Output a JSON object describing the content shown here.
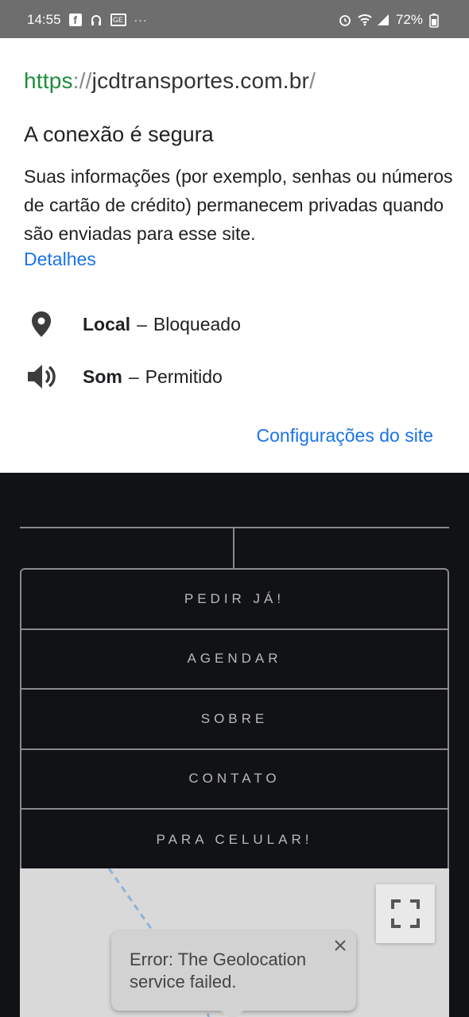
{
  "status_bar": {
    "time": "14:55",
    "icons_left": [
      "facebook-icon",
      "headphone-icon",
      "ge-icon",
      "more-dots-icon"
    ],
    "icons_right": [
      "alarm-icon",
      "wifi-icon",
      "signal-icon",
      "battery-icon"
    ],
    "battery": "72%",
    "more": "···"
  },
  "popup": {
    "url": {
      "protocol": "https",
      "separator": "://",
      "host": "jcdtransportes.com.br",
      "trailing": "/"
    },
    "title": "A conexão é segura",
    "description": "Suas informações (por exemplo, senhas ou números de cartão de crédito) permanecem privadas quando são enviadas para esse site.",
    "details_link": "Detalhes",
    "permissions": [
      {
        "icon": "location-pin-icon",
        "name": "Local",
        "dash": "–",
        "value": "Bloqueado"
      },
      {
        "icon": "speaker-icon",
        "name": "Som",
        "dash": "–",
        "value": "Permitido"
      }
    ],
    "site_settings_link": "Configurações do site"
  },
  "site": {
    "menu": [
      "PEDIR JÁ!",
      "AGENDAR",
      "SOBRE",
      "CONTATO",
      "PARA CELULAR!"
    ],
    "map_error": "Error: The Geolocation service failed."
  },
  "colors": {
    "link": "#1a73e8",
    "https": "#1e8e3e",
    "status_bar": "#6e6e6e",
    "site_bg": "#111215"
  }
}
